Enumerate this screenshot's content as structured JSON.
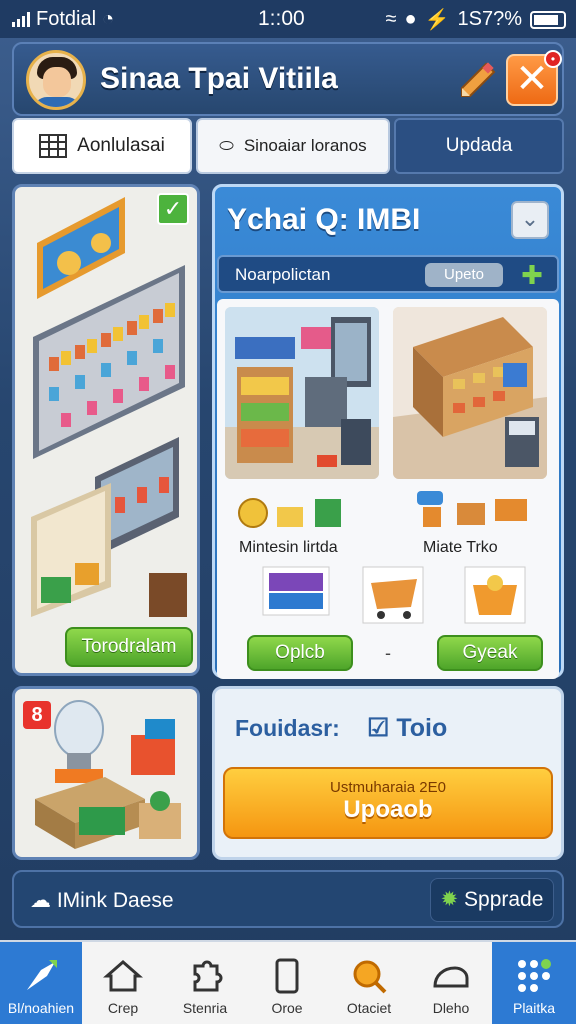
{
  "status": {
    "carrier": "Fotdial",
    "time": "1::00",
    "right": "1S7?%"
  },
  "header": {
    "title": "Sinaa Tpai Vitiila"
  },
  "tabs": [
    {
      "label": "Aonlulasai"
    },
    {
      "label": "Sinoaiar loranos"
    },
    {
      "label": "Updada"
    }
  ],
  "left_card": {
    "button": "Torodralam"
  },
  "left_card2": {
    "badge": "8"
  },
  "panel": {
    "title": "Ychai Q: IMBI",
    "sub_label": "Noarpolictan",
    "sub_button": "Upeto",
    "caption_left": "Mintesin lirtda",
    "caption_right": "Miate Trko",
    "btn_left": "Oplcb",
    "btn_right": "Gyeak",
    "dash": "-"
  },
  "bottom_panel": {
    "label": "Fouidasr:",
    "check_label": "Toio",
    "orange_sub": "Ustmuharaia 2E0",
    "orange_main": "Upoaob"
  },
  "strip": {
    "label": "IMink Daese",
    "button": "Spprade"
  },
  "nav": [
    {
      "label": "Bl/noahien"
    },
    {
      "label": "Crep"
    },
    {
      "label": "Stenria"
    },
    {
      "label": "Oroe"
    },
    {
      "label": "Otaciet"
    },
    {
      "label": "Dleho"
    },
    {
      "label": "Plaitka"
    }
  ],
  "colors": {
    "accent": "#2d7ad3",
    "orange": "#f59611",
    "green": "#4ea52a",
    "header": "#27476f"
  }
}
